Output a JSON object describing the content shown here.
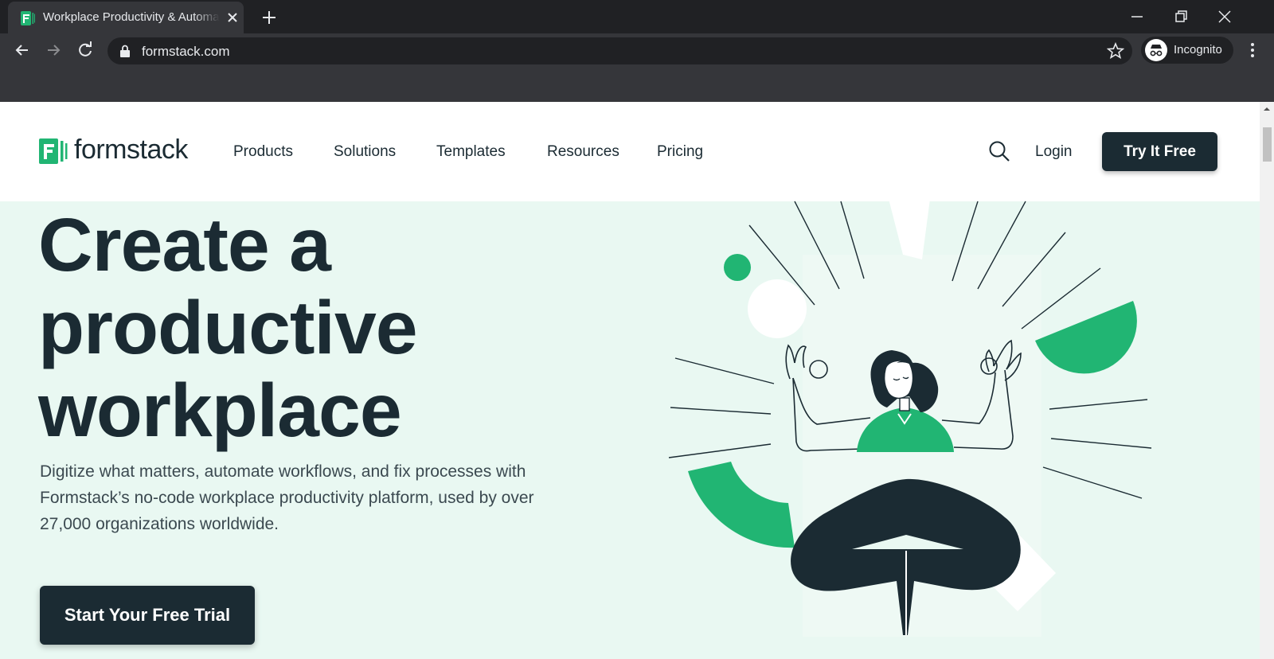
{
  "browser": {
    "tab": {
      "title": "Workplace Productivity & Automation",
      "favicon": "formstack-favicon"
    },
    "url": "formstack.com",
    "profile_label": "Incognito",
    "colors": {
      "frame": "#202124",
      "toolbar": "#35363a",
      "text": "#e8eaed"
    }
  },
  "site": {
    "logo_text": "formstack",
    "nav": [
      "Products",
      "Solutions",
      "Templates",
      "Resources",
      "Pricing"
    ],
    "login": "Login",
    "try_button": "Try It Free",
    "hero": {
      "title_lines": [
        "Create a",
        "productive",
        "workplace"
      ],
      "subtitle_lines": [
        "Digitize what matters, automate workflows, and fix processes with",
        "Formstack’s no-code workplace productivity platform, used by over",
        "27,000 organizations worldwide."
      ],
      "cta": "Start Your Free Trial"
    },
    "colors": {
      "brand_green": "#21b573",
      "dark": "#1b2b33",
      "hero_bg": "#e9f8f2"
    }
  }
}
